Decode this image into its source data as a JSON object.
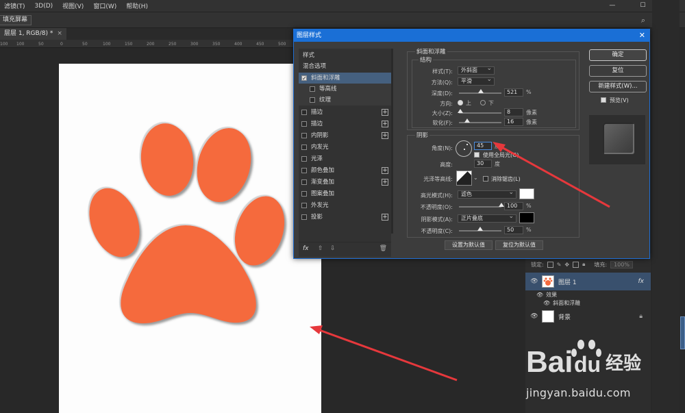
{
  "menu": {
    "items": [
      "滤镜(T)",
      "3D(D)",
      "视图(V)",
      "窗口(W)",
      "帮助(H)"
    ],
    "window_controls": [
      "—",
      "☐",
      "✕"
    ]
  },
  "options_bar": {
    "fill_screen": "填充屏幕"
  },
  "document_tab": {
    "title": "层层 1, RGB/8) *",
    "close": "×"
  },
  "ruler": {
    "ticks": [
      "100",
      "50",
      "0",
      "50",
      "100",
      "150",
      "200",
      "250",
      "300",
      "350",
      "400",
      "450",
      "500"
    ]
  },
  "dialog": {
    "title": "图层样式",
    "close": "✕",
    "left_list": {
      "header": "样式",
      "blend": "混合选项",
      "items": [
        {
          "label": "斜面和浮雕",
          "checked": true,
          "selected": true
        },
        {
          "label": "等高线",
          "checked": false,
          "sub": true
        },
        {
          "label": "纹理",
          "checked": false,
          "sub": true
        },
        {
          "label": "描边",
          "checked": false,
          "plus": true
        },
        {
          "label": "描边",
          "checked": false,
          "plus": true
        },
        {
          "label": "内阴影",
          "checked": false,
          "plus": true
        },
        {
          "label": "内发光",
          "checked": false
        },
        {
          "label": "光泽",
          "checked": false
        },
        {
          "label": "颜色叠加",
          "checked": false,
          "plus": true
        },
        {
          "label": "渐变叠加",
          "checked": false,
          "plus": true
        },
        {
          "label": "图案叠加",
          "checked": false
        },
        {
          "label": "外发光",
          "checked": false
        },
        {
          "label": "投影",
          "checked": false,
          "plus": true
        }
      ],
      "fx_label": "fx"
    },
    "bevel": {
      "section_title": "斜面和浮雕",
      "structure_title": "结构",
      "style_label": "样式(T):",
      "style_value": "外斜面",
      "technique_label": "方法(Q):",
      "technique_value": "平滑",
      "depth_label": "深度(D):",
      "depth_value": "521",
      "depth_fraction": 0.52,
      "depth_unit": "%",
      "direction_label": "方向:",
      "direction_up": "上",
      "direction_down": "下",
      "size_label": "大小(Z):",
      "size_value": "8",
      "size_fraction": 0.03,
      "size_unit": "像素",
      "soften_label": "软化(F):",
      "soften_value": "16",
      "soften_fraction": 0.2,
      "soften_unit": "像素"
    },
    "shading": {
      "title": "阴影",
      "angle_label": "角度(N):",
      "angle_value": "45",
      "angle_unit": "度",
      "global_light": "使用全局光(G)",
      "altitude_label": "高度:",
      "altitude_value": "30",
      "altitude_unit": "度",
      "gloss_label": "光泽等高线:",
      "anti_alias": "消除锯齿(L)",
      "highlight_mode_label": "高光模式(H):",
      "highlight_mode_value": "滤色",
      "highlight_color": "#ffffff",
      "highlight_opacity_label": "不透明度(O):",
      "highlight_opacity_value": "100",
      "highlight_opacity_fraction": 1.0,
      "shadow_mode_label": "阴影模式(A):",
      "shadow_mode_value": "正片叠底",
      "shadow_color": "#000000",
      "shadow_opacity_label": "不透明度(C):",
      "shadow_opacity_value": "50",
      "shadow_opacity_fraction": 0.5,
      "pct": "%"
    },
    "buttons": {
      "make_default": "设置为默认值",
      "reset_default": "复位为默认值",
      "ok": "确定",
      "reset": "复位",
      "new_style": "新建样式(W)...",
      "preview": "预览(V)"
    }
  },
  "layers_panel": {
    "lock_label": "锁定:",
    "fill_label": "填充:",
    "fill_value": "100%",
    "layer1": "图层 1",
    "layer1_fx": "fx",
    "effects": "效果",
    "bevel_effect": "斜面和浮雕",
    "background": "背景"
  },
  "colors": {
    "paw": "#f56a3d",
    "dialog_title": "#1a6fd6",
    "arrow": "#e6383c"
  },
  "watermark": {
    "logo_text_left": "Bai",
    "logo_text_right": "du",
    "logo_cn": "经验",
    "url": "jingyan.baidu.com"
  }
}
